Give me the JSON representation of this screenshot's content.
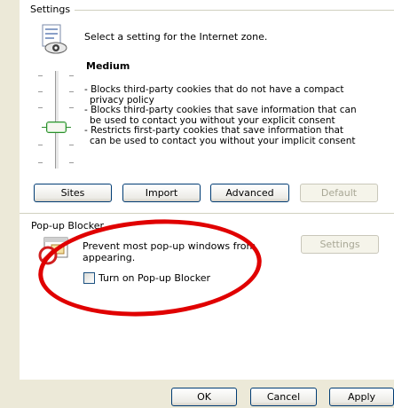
{
  "settings": {
    "group_label": "Settings",
    "zone_instruction": "Select a setting for the Internet zone.",
    "level_title": "Medium",
    "description_lines": [
      "- Blocks third-party cookies that do not have a compact",
      "privacy policy",
      "- Blocks third-party cookies that save information that can",
      "be used to contact you without your explicit consent",
      "- Restricts first-party cookies that save information that",
      "can be used to contact you without your implicit consent"
    ],
    "slider_level": "Medium",
    "buttons": {
      "sites": "Sites",
      "import": "Import",
      "advanced": "Advanced",
      "default": "Default"
    }
  },
  "popup": {
    "group_label": "Pop-up Blocker",
    "description_line1": "Prevent most pop-up windows from",
    "description_line2": "appearing.",
    "settings_button": "Settings",
    "checkbox_label": "Turn on Pop-up Blocker",
    "checkbox_checked": false
  },
  "footer": {
    "ok": "OK",
    "cancel": "Cancel",
    "apply": "Apply"
  },
  "colors": {
    "annotation": "#e00000",
    "dialog_face": "#ece9d8",
    "button_border": "#003c74"
  },
  "icons": [
    "internet-zone-icon",
    "popup-blocked-icon"
  ]
}
